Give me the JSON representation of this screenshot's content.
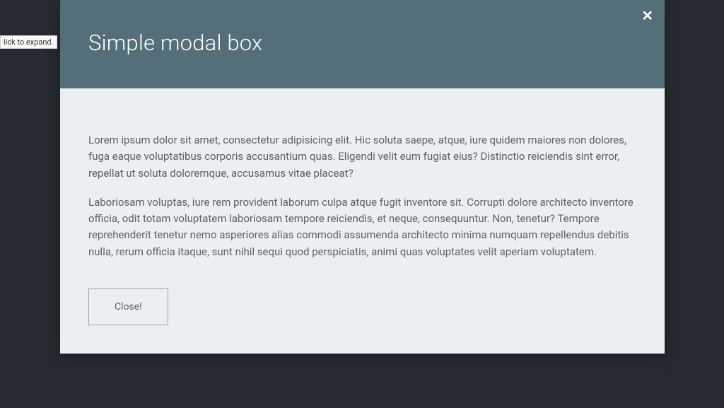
{
  "tooltip": {
    "text": "lick to expand."
  },
  "modal": {
    "title": "Simple modal box",
    "close_icon_glyph": "✕",
    "paragraphs": [
      "Lorem ipsum dolor sit amet, consectetur adipisicing elit. Hic soluta saepe, atque, iure quidem maiores non dolores, fuga eaque voluptatibus corporis accusantium quas. Eligendi velit eum fugiat eius? Distinctio reiciendis sint error, repellat ut soluta doloremque, accusamus vitae placeat?",
      "Laboriosam voluptas, iure rem provident laborum culpa atque fugit inventore sit. Corrupti dolore architecto inventore officia, odit totam voluptatem laboriosam tempore reiciendis, et neque, consequuntur. Non, tenetur? Tempore reprehenderit tenetur nemo asperiores alias commodi assumenda architecto minima numquam repellendus debitis nulla, rerum officia itaque, sunt nihil sequi quod perspiciatis, animi quas voluptates velit aperiam voluptatem."
    ],
    "close_button_label": "Close!"
  }
}
